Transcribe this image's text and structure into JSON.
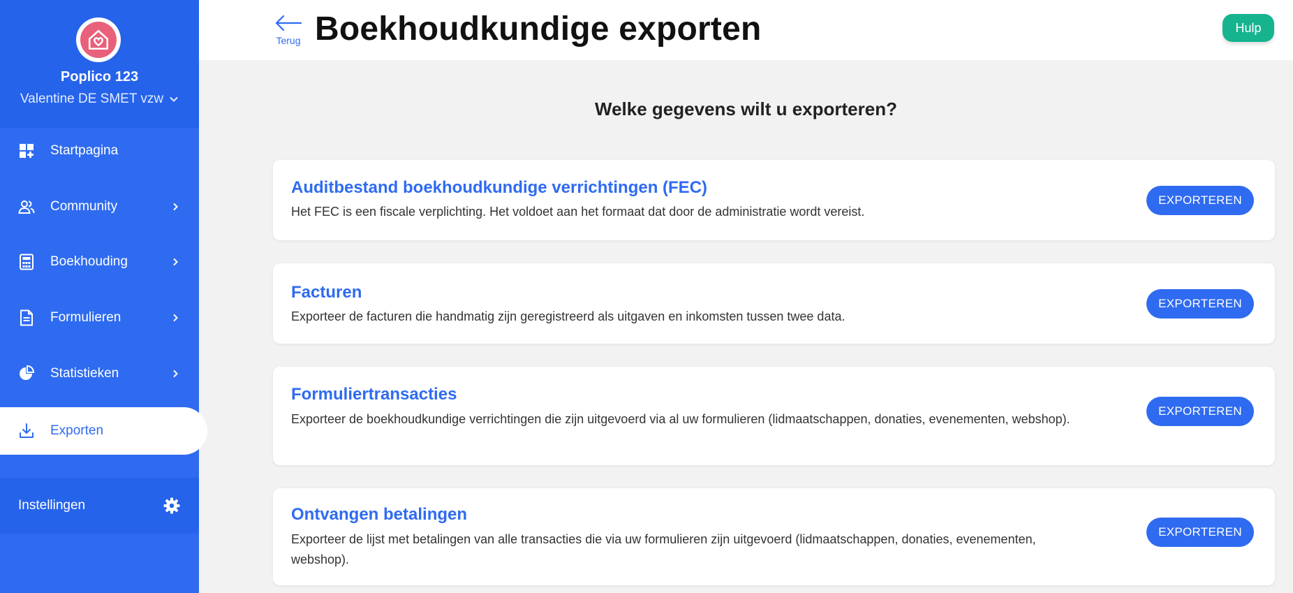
{
  "organization": {
    "name": "Poplico 123",
    "account": "Valentine DE SMET vzw"
  },
  "sidebar": {
    "items": [
      {
        "label": "Startpagina",
        "icon": "dashboard-icon",
        "has_submenu": false
      },
      {
        "label": "Community",
        "icon": "users-icon",
        "has_submenu": true
      },
      {
        "label": "Boekhouding",
        "icon": "calculator-icon",
        "has_submenu": true
      },
      {
        "label": "Formulieren",
        "icon": "document-icon",
        "has_submenu": true
      },
      {
        "label": "Statistieken",
        "icon": "pie-chart-icon",
        "has_submenu": true
      },
      {
        "label": "Exporten",
        "icon": "download-icon",
        "has_submenu": false,
        "active": true
      }
    ],
    "settings_label": "Instellingen"
  },
  "header": {
    "back_label": "Terug",
    "title": "Boekhoudkundige exporten",
    "help_label": "Hulp"
  },
  "main": {
    "question": "Welke gegevens wilt u exporteren?",
    "cards": [
      {
        "title": "Auditbestand boekhoudkundige verrichtingen (FEC)",
        "description": "Het FEC is een fiscale verplichting. Het voldoet aan het formaat dat door de administratie wordt vereist.",
        "button": "EXPORTEREN"
      },
      {
        "title": "Facturen",
        "description": "Exporteer de facturen die handmatig zijn geregistreerd als uitgaven en inkomsten tussen twee data.",
        "button": "EXPORTEREN"
      },
      {
        "title": "Formuliertransacties",
        "description": "Exporteer de boekhoudkundige verrichtingen die zijn uitgevoerd via al uw formulieren (lidmaatschappen, donaties, evenementen, webshop).",
        "button": "EXPORTEREN"
      },
      {
        "title": "Ontvangen betalingen",
        "description": "Exporteer de lijst met betalingen van alle transacties die via uw formulieren zijn uitgevoerd (lidmaatschappen, donaties, evenementen, webshop).",
        "button": "EXPORTEREN"
      }
    ]
  },
  "colors": {
    "sidebar": "#2f6bf0",
    "sidebar_dark": "#2563eb",
    "accent": "#2f6bf0",
    "help": "#16b38f",
    "logo": "#e8607a"
  }
}
